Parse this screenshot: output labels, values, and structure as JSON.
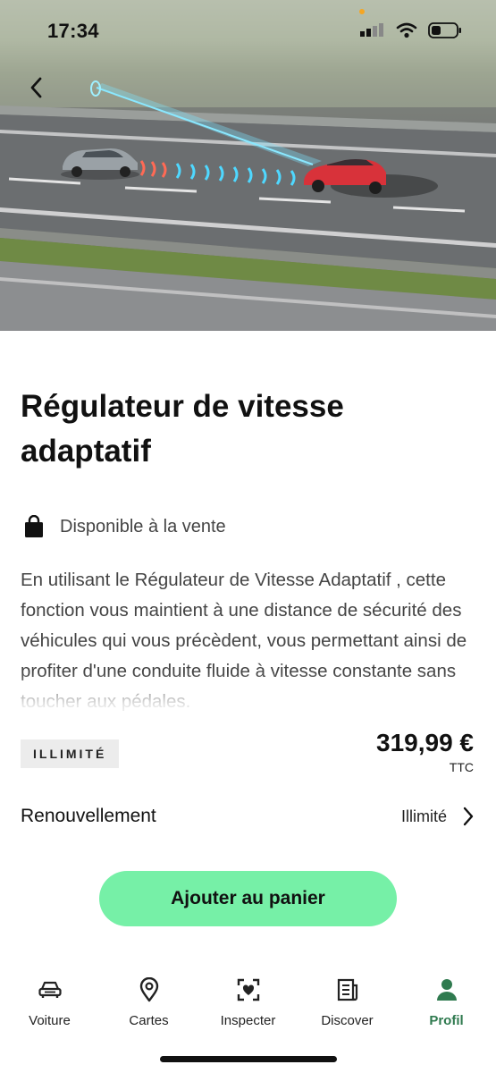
{
  "status_bar": {
    "time": "17:34"
  },
  "hero": {
    "image": "adaptive-cruise-control-illustration"
  },
  "product": {
    "title": "Régulateur de vitesse adaptatif",
    "availability": "Disponible à la vente",
    "description": "En utilisant le  Régulateur de Vitesse Adaptatif  , cette fonction vous maintient à une distance de sécurité des véhicules qui vous précèdent, vous permettant ainsi de profiter d'une conduite fluide à vitesse constante sans toucher aux pédales.",
    "badge": "ILLIMITÉ",
    "price": "319,99 €",
    "price_tax": "TTC"
  },
  "renewal": {
    "label": "Renouvellement",
    "value": "Illimité"
  },
  "cta": {
    "label": "Ajouter au panier"
  },
  "tabs": [
    {
      "label": "Voiture",
      "icon": "car-icon"
    },
    {
      "label": "Cartes",
      "icon": "map-pin-icon"
    },
    {
      "label": "Inspecter",
      "icon": "inspect-heart-icon"
    },
    {
      "label": "Discover",
      "icon": "news-icon"
    },
    {
      "label": "Profil",
      "icon": "profile-icon"
    }
  ],
  "colors": {
    "accent": "#76f0a7",
    "active_tab": "#2f7a4f"
  }
}
